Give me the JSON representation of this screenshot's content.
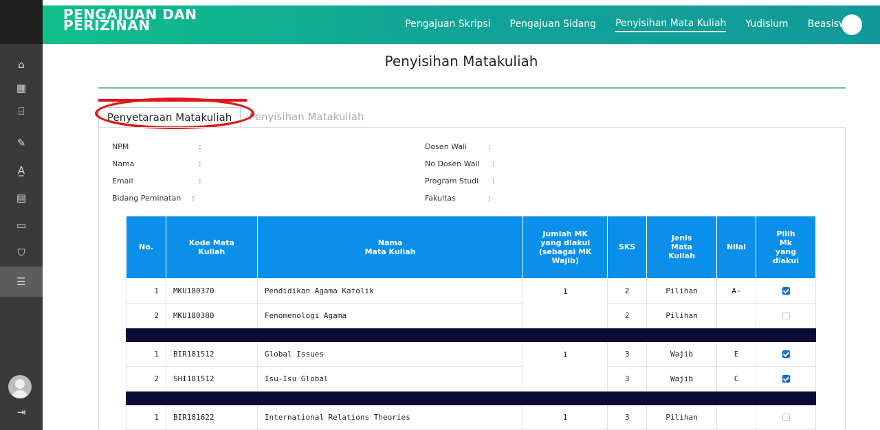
{
  "header": {
    "brand_line1": "PENGAJUAN DAN",
    "brand_line2": "PERIZINAN",
    "nav": [
      {
        "label": "Pengajuan Skripsi",
        "active": false
      },
      {
        "label": "Pengajuan Sidang",
        "active": false
      },
      {
        "label": "Penyisihan Mata Kuliah",
        "active": true
      },
      {
        "label": "Yudisium",
        "active": false
      },
      {
        "label": "Beasiswa",
        "active": false
      }
    ]
  },
  "sidebar": {
    "icons": [
      "home-icon",
      "calendar-icon",
      "building-icon",
      "document-edit-icon",
      "font-grade-icon",
      "certificate-icon",
      "message-icon",
      "graduation-cap-icon",
      "list-document-icon"
    ],
    "active_index": 8,
    "footer_icons": [
      "user-avatar",
      "logout-icon"
    ]
  },
  "page": {
    "title": "Penyisihan Matakuliah",
    "tabs": [
      {
        "label": "Penyetaraan Matakuliah",
        "active": true
      },
      {
        "label": "Penyisihan Matakuliah",
        "active": false
      }
    ]
  },
  "info": {
    "left": [
      {
        "label": "NPM",
        "value": ""
      },
      {
        "label": "Nama",
        "value": ""
      },
      {
        "label": "Email",
        "value": ""
      },
      {
        "label": "Bidang Peminatan",
        "value": ""
      }
    ],
    "right": [
      {
        "label": "Dosen Wali",
        "value": ""
      },
      {
        "label": "No Dosen Wali",
        "value": ""
      },
      {
        "label": "Program Studi",
        "value": ""
      },
      {
        "label": "Fakultas",
        "value": ""
      }
    ]
  },
  "table": {
    "headers": {
      "no": "No.",
      "kode": "Kode Mata Kuliah",
      "nama_l1": "Nama",
      "nama_l2": "Mata Kuliah",
      "jumlah": "Jumlah MK yang diakui (sebagai MK Wajib)",
      "sks": "SKS",
      "jenis": "Jenis Mata Kuliah",
      "nilai": "Nilai",
      "pilih": "Pilih Mk yang diakui"
    },
    "groups": [
      {
        "jumlah": "1",
        "rows": [
          {
            "no": "1",
            "kode": "MKU180370",
            "nama": "Pendidikan Agama Katolik",
            "sks": "2",
            "jenis": "Pilihan",
            "nilai": "A-",
            "checked": true
          },
          {
            "no": "2",
            "kode": "MKU180380",
            "nama": "Fenomenologi Agama",
            "sks": "2",
            "jenis": "Pilihan",
            "nilai": "",
            "checked": false
          }
        ]
      },
      {
        "jumlah": "1",
        "rows": [
          {
            "no": "1",
            "kode": "BIR181512",
            "nama": "Global Issues",
            "sks": "3",
            "jenis": "Wajib",
            "nilai": "E",
            "checked": true
          },
          {
            "no": "2",
            "kode": "SHI181512",
            "nama": "Isu-Isu Global",
            "sks": "3",
            "jenis": "Wajib",
            "nilai": "C",
            "checked": true
          }
        ]
      },
      {
        "jumlah": "1",
        "rows": [
          {
            "no": "1",
            "kode": "BIR181622",
            "nama": "International Relations Theories",
            "sks": "3",
            "jenis": "Pilihan",
            "nilai": "",
            "checked": false
          }
        ]
      }
    ]
  }
}
